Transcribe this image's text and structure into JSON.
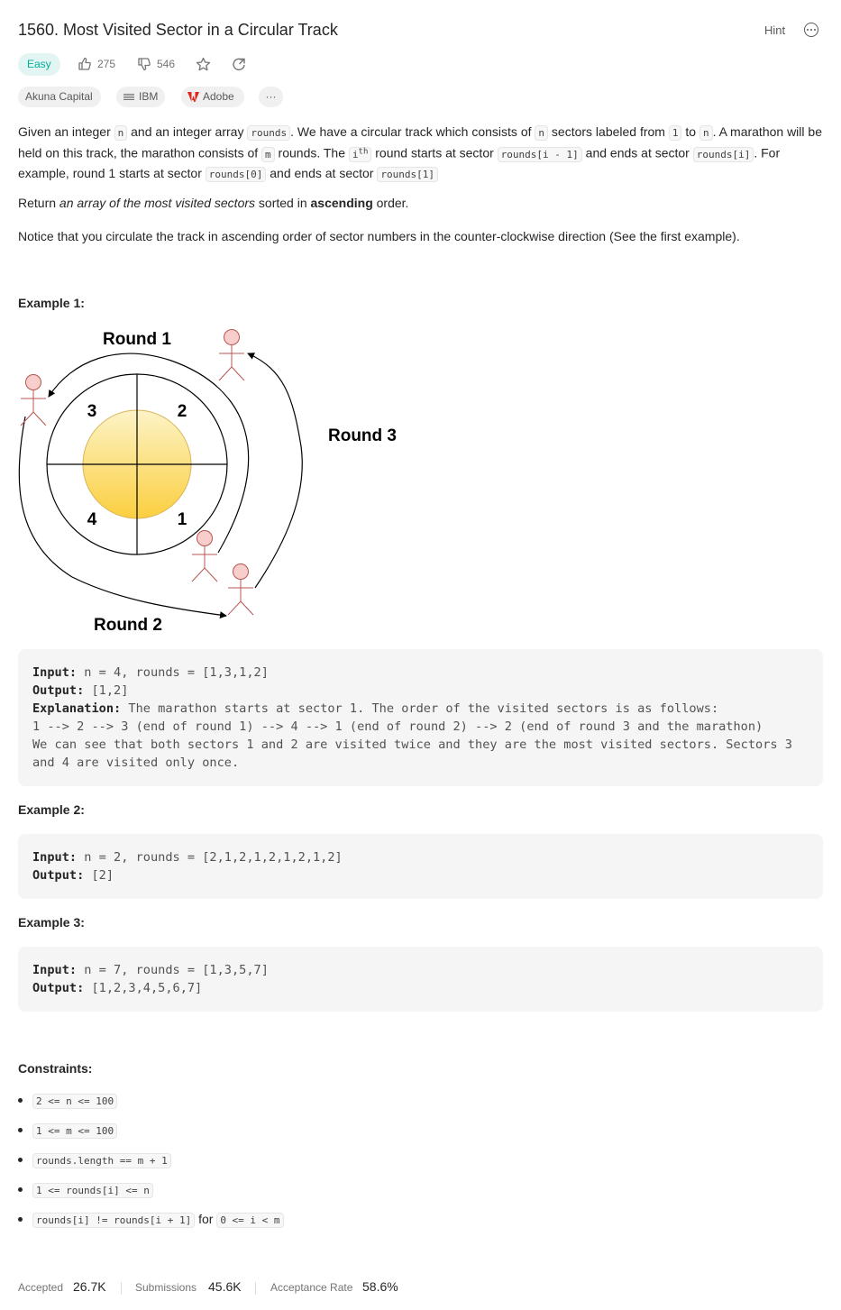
{
  "problem": {
    "title": "1560. Most Visited Sector in a Circular Track",
    "hint_label": "Hint",
    "difficulty": "Easy",
    "likes": "275",
    "dislikes": "546"
  },
  "companies": [
    "Akuna Capital",
    "IBM",
    "Adobe"
  ],
  "more_tags_label": "···",
  "description": {
    "p1": {
      "t1": "Given an integer ",
      "c1": "n",
      "t2": " and an integer array ",
      "c2": "rounds",
      "t3": ". We have a circular track which consists of ",
      "c3": "n",
      "t4": " sectors labeled from ",
      "c4": "1",
      "t5": " to ",
      "c5": "n",
      "t6": ". A marathon will be held on this track, the marathon consists of ",
      "c6": "m",
      "t7": " rounds. The ",
      "c7": "i",
      "sup": "th",
      "t8": " round starts at sector ",
      "c8": "rounds[i - 1]",
      "t9": " and ends at sector ",
      "c9": "rounds[i]",
      "t10": ". For example, round 1 starts at sector ",
      "c10": "rounds[0]",
      "t11": " and ends at sector ",
      "c11": "rounds[1]"
    },
    "p2": {
      "t1": "Return ",
      "em": "an array of the most visited sectors",
      "t2": " sorted in ",
      "strong": "ascending",
      "t3": " order."
    },
    "p3": "Notice that you circulate the track in ascending order of sector numbers in the counter-clockwise direction (See the first example)."
  },
  "diagram": {
    "labels": {
      "round1": "Round 1",
      "round2": "Round 2",
      "round3": "Round 3",
      "s1": "1",
      "s2": "2",
      "s3": "3",
      "s4": "4"
    },
    "colors": {
      "sun_top": "#fdf3c6",
      "sun_bottom": "#fbcf40",
      "figure": "#b85450",
      "figure_fill": "#f8cecc"
    }
  },
  "examples": [
    {
      "title": "Example 1:",
      "input_label": "Input:",
      "input": " n = 4, rounds = [1,3,1,2]",
      "output_label": "Output:",
      "output": " [1,2]",
      "explanation_label": "Explanation:",
      "explanation": " The marathon starts at sector 1. The order of the visited sectors is as follows:\n1 --> 2 --> 3 (end of round 1) --> 4 --> 1 (end of round 2) --> 2 (end of round 3 and the marathon)\nWe can see that both sectors 1 and 2 are visited twice and they are the most visited sectors. Sectors 3 and 4 are visited only once."
    },
    {
      "title": "Example 2:",
      "input_label": "Input:",
      "input": " n = 2, rounds = [2,1,2,1,2,1,2,1,2]",
      "output_label": "Output:",
      "output": " [2]"
    },
    {
      "title": "Example 3:",
      "input_label": "Input:",
      "input": " n = 7, rounds = [1,3,5,7]",
      "output_label": "Output:",
      "output": " [1,2,3,4,5,6,7]"
    }
  ],
  "constraints": {
    "title": "Constraints:",
    "items": [
      "2 <= n <= 100",
      "1 <= m <= 100",
      "rounds.length == m + 1",
      "1 <= rounds[i] <= n"
    ],
    "last": {
      "c1": "rounds[i] != rounds[i + 1]",
      "t": " for ",
      "c2": "0 <= i < m"
    }
  },
  "stats": {
    "accepted_label": "Accepted",
    "accepted": "26.7K",
    "submissions_label": "Submissions",
    "submissions": "45.6K",
    "rate_label": "Acceptance Rate",
    "rate": "58.6%"
  }
}
